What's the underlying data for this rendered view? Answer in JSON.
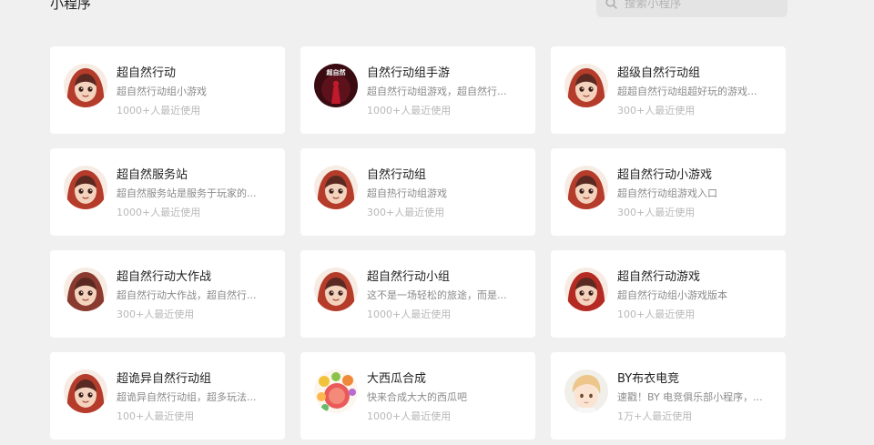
{
  "page": {
    "title": "小程序"
  },
  "search": {
    "placeholder": "搜索小程序"
  },
  "items": [
    {
      "name": "超自然行动",
      "desc": "超自然行动组小游戏",
      "usage": "1000+人最近使用",
      "icon": "red-hood-girl-icon",
      "color": "#b53b2a"
    },
    {
      "name": "自然行动组手游",
      "desc": "超自然行动组游戏，超自然行...",
      "usage": "1000+人最近使用",
      "icon": "dark-red-poster-icon",
      "color": "#3a0c12",
      "icon_text": "超自然"
    },
    {
      "name": "超级自然行动组",
      "desc": "超超自然行动组超好玩的游戏...",
      "usage": "300+人最近使用",
      "icon": "red-hood-girl-icon",
      "color": "#b53b2a"
    },
    {
      "name": "超自然服务站",
      "desc": "超自然服务站是服务于玩家的...",
      "usage": "1000+人最近使用",
      "icon": "red-hood-girl-icon",
      "color": "#b53b2a"
    },
    {
      "name": "自然行动组",
      "desc": "超自热行动组游戏",
      "usage": "300+人最近使用",
      "icon": "red-hood-girl-icon",
      "color": "#b53b2a"
    },
    {
      "name": "超自然行动小游戏",
      "desc": "超自然行动组游戏入口",
      "usage": "300+人最近使用",
      "icon": "red-hood-girl-icon",
      "color": "#b53b2a"
    },
    {
      "name": "超自然行动大作战",
      "desc": "超自然行动大作战，超自然行...",
      "usage": "300+人最近使用",
      "icon": "red-hood-girl-icon",
      "color": "#8a3a2e"
    },
    {
      "name": "超自然行动小组",
      "desc": "这不是一场轻松的旅途，而是...",
      "usage": "1000+人最近使用",
      "icon": "red-hood-girl-icon",
      "color": "#b53b2a"
    },
    {
      "name": "超自然行动游戏",
      "desc": "超自然行动组小游戏版本",
      "usage": "100+人最近使用",
      "icon": "red-hood-girl-icon",
      "color": "#b52a22"
    },
    {
      "name": "超诡异自然行动组",
      "desc": "超诡异自然行动组，超多玩法...",
      "usage": "100+人最近使用",
      "icon": "red-hood-girl-icon",
      "color": "#b53b2a"
    },
    {
      "name": "大西瓜合成",
      "desc": "快来合成大大的西瓜吧",
      "usage": "1000+人最近使用",
      "icon": "watermelon-fruits-icon",
      "color": "#e04a4a"
    },
    {
      "name": "BY布衣电竞",
      "desc": "速戳！BY 电竞俱乐部小程序，...",
      "usage": "1万+人最近使用",
      "icon": "blond-boy-avatar-icon",
      "color": "#e9c98a"
    }
  ]
}
